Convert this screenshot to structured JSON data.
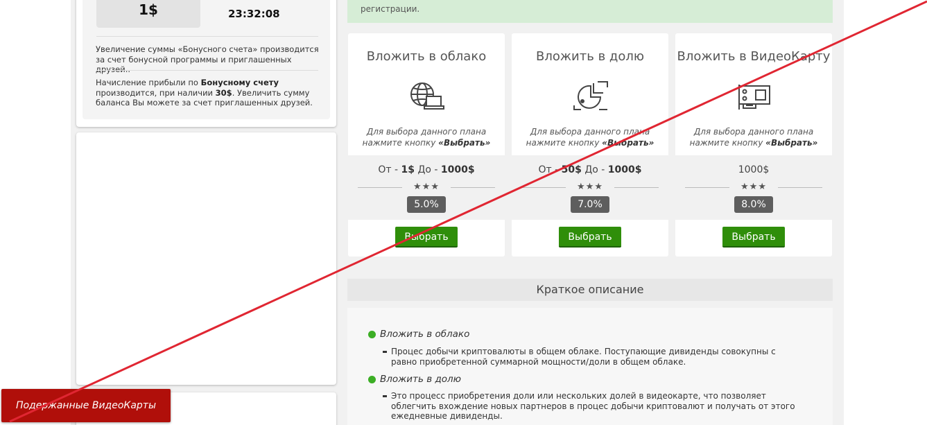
{
  "bonus": {
    "amount": "1$",
    "timer": "23:32:08",
    "text1": "Увеличение суммы «Бонусного счета» производится за счет бонусной программы и приглашенных друзей..",
    "text2_a": "Начисление прибыли по ",
    "text2_b": "Бонусному счету",
    "text2_c": " производится, при наличии ",
    "text2_d": "30$",
    "text2_e": ". Увеличить сумму баланса Вы можете за счет приглашенных друзей."
  },
  "notice": {
    "text": "регистрации."
  },
  "plans": [
    {
      "title": "Вложить в облако",
      "icon": "globe-laptop-icon",
      "hint_line1": "Для выбора данного плана",
      "hint_line2": "нажмите кнопку ",
      "hint_bold": "«Выбрать»",
      "range_from_label": "От - ",
      "range_from": "1$",
      "range_to_label": " До - ",
      "range_to": "1000$",
      "stars": "★★★",
      "rate": "5.0%",
      "button": "Выбрать"
    },
    {
      "title": "Вложить в долю",
      "icon": "pie-share-icon",
      "hint_line1": "Для выбора данного плана",
      "hint_line2": "нажмите кнопку ",
      "hint_bold": "«Выбрать»",
      "range_from_label": "От - ",
      "range_from": "50$",
      "range_to_label": " До - ",
      "range_to": "1000$",
      "stars": "★★★",
      "rate": "7.0%",
      "button": "Выбрать"
    },
    {
      "title": "Вложить в ВидеоКарту",
      "icon": "graphics-card-icon",
      "hint_line1": "Для выбора данного плана",
      "hint_line2": "нажмите кнопку ",
      "hint_bold": "«Выбрать»",
      "range": "1000$",
      "stars": "★★★",
      "rate": "8.0%",
      "button": "Выбрать"
    }
  ],
  "brief": {
    "heading": "Краткое описание",
    "items": [
      {
        "title": "Вложить в облако",
        "text": "Процес добычи криптовалюты в общем облаке. Поступающие дивиденды совокупны с равно приобретенной суммарной мощности/доли в общем облаке."
      },
      {
        "title": "Вложить в долю",
        "text": "Это процесс приобретения доли или нескольких долей в видеокарте, что позволяет облегчить вхождение новых партнеров в процес добычи криптовалют и получать от этого ежедневные дивиденды."
      }
    ]
  },
  "bottom_button": "Подержанные ВидеоКарты",
  "colors": {
    "accent_green": "#2f8e0a",
    "bullet_green": "#3cae25",
    "notice_bg": "#d6edd6",
    "bottom_red": "#b00f0a",
    "strike_red": "#e02632"
  }
}
